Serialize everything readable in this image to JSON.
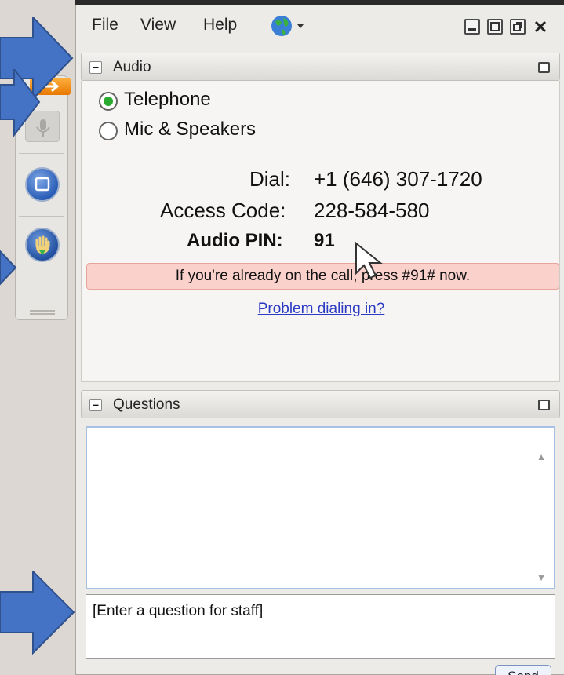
{
  "menu": {
    "file": "File",
    "view": "View",
    "help": "Help"
  },
  "audio_panel": {
    "title": "Audio",
    "options": [
      {
        "label": "Telephone",
        "selected": true
      },
      {
        "label": "Mic & Speakers",
        "selected": false
      }
    ],
    "dial_label": "Dial:",
    "dial_value": "+1 (646) 307-1720",
    "access_code_label": "Access Code:",
    "access_code_value": "228-584-580",
    "audio_pin_label": "Audio PIN:",
    "audio_pin_value": "91",
    "notice": "If you're already on the call, press #91# now.",
    "problem_link": "Problem dialing in?"
  },
  "questions_panel": {
    "title": "Questions",
    "input_text": "[Enter a question for staff]",
    "send_label": "Send"
  },
  "colors": {
    "annotation_arrow": "#4472c4",
    "radio_selected": "#2bab2f",
    "notice_bg": "#fbd1cc",
    "link": "#2c3ac4"
  }
}
